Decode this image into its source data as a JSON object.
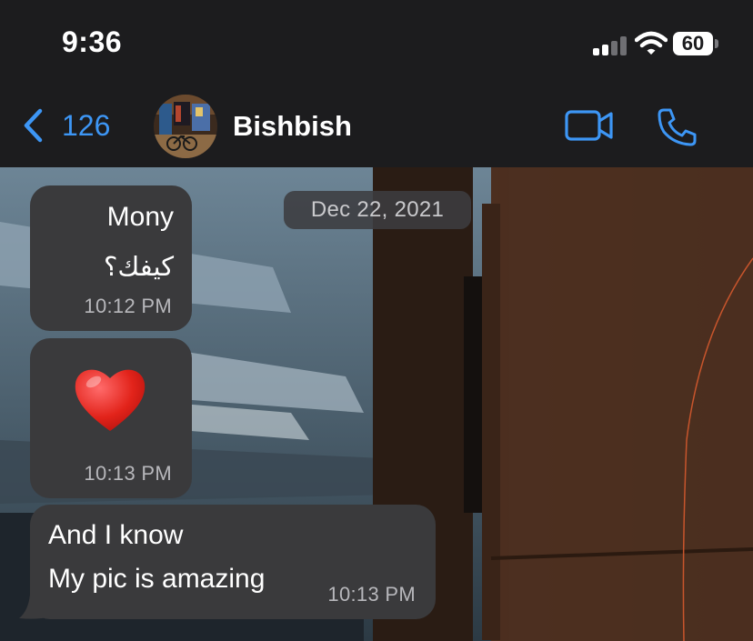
{
  "status_bar": {
    "time": "9:36",
    "battery_level": "60",
    "signal_icon": "cellular-signal-icon",
    "wifi_icon": "wifi-icon",
    "battery_icon": "battery-icon"
  },
  "nav": {
    "back_count": "126",
    "back_icon": "chevron-left-icon",
    "contact_name": "Bishbish",
    "video_icon": "video-camera-icon",
    "call_icon": "phone-icon",
    "accent_color": "#3d96f5"
  },
  "chat": {
    "date_label": "Dec 22, 2021",
    "messages": [
      {
        "lines": [
          "Mony",
          "كيفك؟"
        ],
        "time": "10:12 PM"
      },
      {
        "emoji": "heart",
        "time": "10:13 PM"
      },
      {
        "lines": [
          "And I know",
          "My pic is amazing"
        ],
        "time": "10:13 PM"
      }
    ],
    "bubble_color": "#3a3a3c"
  }
}
